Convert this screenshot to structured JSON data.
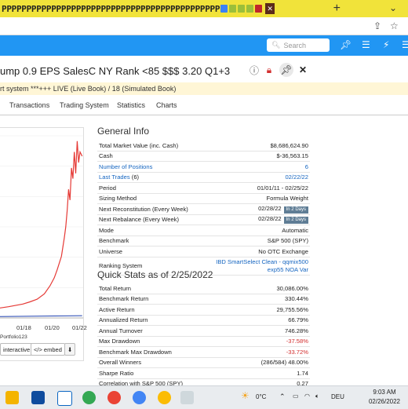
{
  "browser": {
    "tabs_text": "PPPPPPPPPPPPPPPPPPPPPPPPPPPPPPPPPPPPPPPPPPPP",
    "new_tab": "+",
    "search_placeholder": "Search"
  },
  "page": {
    "title": "ump 0.9 EPS SalesC NY Rank <85 $$$ 3.20 Q1+3",
    "notice": "rt system ***+++ LIVE (Live Book) / 18 (Simulated Book)",
    "tabs": [
      "Transactions",
      "Trading System",
      "Statistics",
      "Charts"
    ]
  },
  "chart_data": {
    "type": "line",
    "x_tick_labels": [
      "01/18",
      "01/20",
      "01/22"
    ],
    "series": [
      {
        "name": "Portfolio123",
        "color": "#e53935",
        "x": [
          2011.0,
          2012.0,
          2013.0,
          2014.0,
          2015.0,
          2016.0,
          2017.0,
          2018.0,
          2018.5,
          2019.0,
          2019.5,
          2019.9,
          2020.2,
          2020.4,
          2020.7,
          2020.9,
          2021.0,
          2021.1,
          2021.2,
          2021.3,
          2021.4,
          2021.5,
          2021.6,
          2021.7,
          2021.8,
          2021.9,
          2022.0,
          2022.15
        ],
        "y": [
          100,
          300,
          600,
          900,
          1300,
          1700,
          2100,
          2600,
          3000,
          3500,
          4500,
          6000,
          7500,
          9000,
          11500,
          15000,
          17000,
          20000,
          24000,
          22000,
          28000,
          26000,
          31000,
          27000,
          33000,
          29000,
          31000,
          30186
        ]
      },
      {
        "color": "#1e40af",
        "x": [
          2011.0,
          2022.15
        ],
        "y": [
          100,
          430
        ]
      }
    ],
    "legend": "bottom-left"
  },
  "chart_controls": {
    "legend_label": "Portfolio123",
    "interactive": "interactive",
    "embed": "</> embed"
  },
  "general_info": {
    "title": "General Info",
    "rows": [
      {
        "label": "Total Market Value (inc. Cash)",
        "value": "$8,686,624.90"
      },
      {
        "label": "Cash",
        "value": "$-36,563.15"
      },
      {
        "label": "Number of Positions",
        "value": "6",
        "link": true
      },
      {
        "label": "Last Trades",
        "count": "(6)",
        "value": "02/22/22",
        "link": true
      },
      {
        "label": "Period",
        "value": "01/01/11 - 02/25/22"
      },
      {
        "label": "Sizing Method",
        "value": "Formula Weight"
      },
      {
        "label": "Next Reconstitution (Every Week)",
        "value": "02/28/22",
        "badge": "In 2 Days"
      },
      {
        "label": "Next Rebalance (Every Week)",
        "value": "02/28/22",
        "badge": "In 2 Days"
      },
      {
        "label": "Mode",
        "value": "Automatic"
      },
      {
        "label": "Benchmark",
        "value": "S&P 500 (SPY)"
      },
      {
        "label": "Universe",
        "value": "No OTC Exchange"
      },
      {
        "label": "Ranking System",
        "value": "IBD SmartSelect Clean - qqmix500",
        "value2": "exp55 NOA Var"
      }
    ]
  },
  "quick_stats": {
    "title": "Quick Stats as of 2/25/2022",
    "rows": [
      {
        "label": "Total Return",
        "value": "30,086.00%"
      },
      {
        "label": "Benchmark Return",
        "value": "330.44%"
      },
      {
        "label": "Active Return",
        "value": "29,755.56%"
      },
      {
        "label": "Annualized Return",
        "value": "66.79%"
      },
      {
        "label": "Annual Turnover",
        "value": "746.28%"
      },
      {
        "label": "Max Drawdown",
        "value": "-37.58%",
        "red": true
      },
      {
        "label": "Benchmark Max Drawdown",
        "value": "-33.72%",
        "red": true
      },
      {
        "label": "Overall Winners",
        "value": "(286/584) 48.00%"
      },
      {
        "label": "Sharpe Ratio",
        "value": "1.74"
      },
      {
        "label": "Correlation with S&P 500 (SPY)",
        "value": "0.27"
      }
    ]
  },
  "taskbar": {
    "temperature": "0°C",
    "language": "DEU",
    "time": "9:03 AM",
    "date": "02/26/2022"
  }
}
